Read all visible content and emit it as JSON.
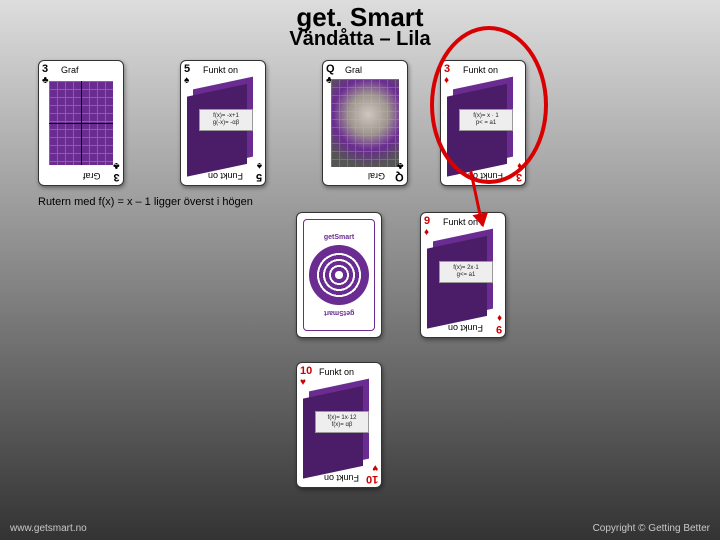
{
  "title": "get. Smart",
  "subtitle": "Vändåtta – Lila",
  "caption": "Rutern med f(x) = x – 1 ligger överst i högen",
  "footer_left": "www.getsmart.no",
  "footer_right": "Copyright © Getting Better",
  "labels": {
    "graf": "Graf",
    "funk": "Funkt on",
    "gral": "Gral"
  },
  "back": {
    "top": "getSmart",
    "bottom": "getSmart"
  },
  "cards": {
    "row1": [
      {
        "rank": "3",
        "suit": "♣",
        "color": "black",
        "kind": "graf"
      },
      {
        "rank": "5",
        "suit": "♠",
        "color": "black",
        "kind": "funk",
        "formula_top": "f(x)= -x+1",
        "formula_bot": "g(-x)= -αβ"
      },
      {
        "rank": "Q",
        "suit": "♣",
        "color": "black",
        "kind": "gral"
      },
      {
        "rank": "3",
        "suit": "♦",
        "color": "red",
        "kind": "funk",
        "formula_top": "f(x)= x · 1",
        "formula_bot": "p< = a1"
      }
    ],
    "row2": [
      {
        "kind": "back"
      },
      {
        "rank": "9",
        "suit": "♦",
        "color": "red",
        "kind": "funk",
        "formula_top": "f(x)= 2x·1",
        "formula_bot": "g<= a1"
      }
    ],
    "row3": [
      {
        "rank": "10",
        "suit": "♥",
        "color": "red",
        "kind": "funk",
        "formula_top": "f(x)= 1x·12",
        "formula_bot": "f(x)= αβ"
      }
    ]
  }
}
